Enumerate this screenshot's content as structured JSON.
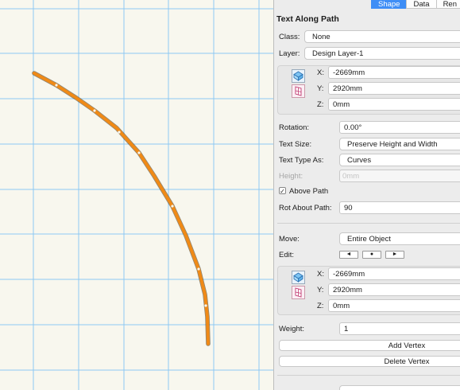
{
  "tabs": [
    "Shape",
    "Data",
    "Ren"
  ],
  "panel_title": "Text Along Path",
  "class_field": {
    "label": "Class:",
    "value": "None"
  },
  "layer_field": {
    "label": "Layer:",
    "value": "Design Layer-1"
  },
  "position_1": {
    "x_label": "X:",
    "x_value": "-2669mm",
    "y_label": "Y:",
    "y_value": "2920mm",
    "z_label": "Z:",
    "z_value": "0mm"
  },
  "rotation": {
    "label": "Rotation:",
    "value": "0.00°"
  },
  "text_size": {
    "label": "Text Size:",
    "value": "Preserve Height and Width"
  },
  "text_type": {
    "label": "Text Type As:",
    "value": "Curves"
  },
  "height": {
    "label": "Height:",
    "value": "0mm"
  },
  "above_path": {
    "label": "Above Path",
    "checked": true,
    "mark": "✓"
  },
  "rot_about_path": {
    "label": "Rot About Path:",
    "value": "90"
  },
  "move": {
    "label": "Move:",
    "value": "Entire Object"
  },
  "edit": {
    "label": "Edit:",
    "buttons": [
      "◄",
      "●",
      "►"
    ]
  },
  "position_2": {
    "x_label": "X:",
    "x_value": "-2669mm",
    "y_label": "Y:",
    "y_value": "2920mm",
    "z_label": "Z:",
    "z_value": "0mm"
  },
  "weight": {
    "label": "Weight:",
    "value": "1"
  },
  "add_vertex": "Add Vertex",
  "delete_vertex": "Delete Vertex",
  "colors": {
    "accent": "#3f8ef6",
    "grid": "#8ec9f4",
    "path": "#f08a16",
    "canvas": "#f8f7ee"
  },
  "icons": {
    "position_icon": "3d-locus-icon",
    "object_icon": "screen-plane-icon"
  }
}
